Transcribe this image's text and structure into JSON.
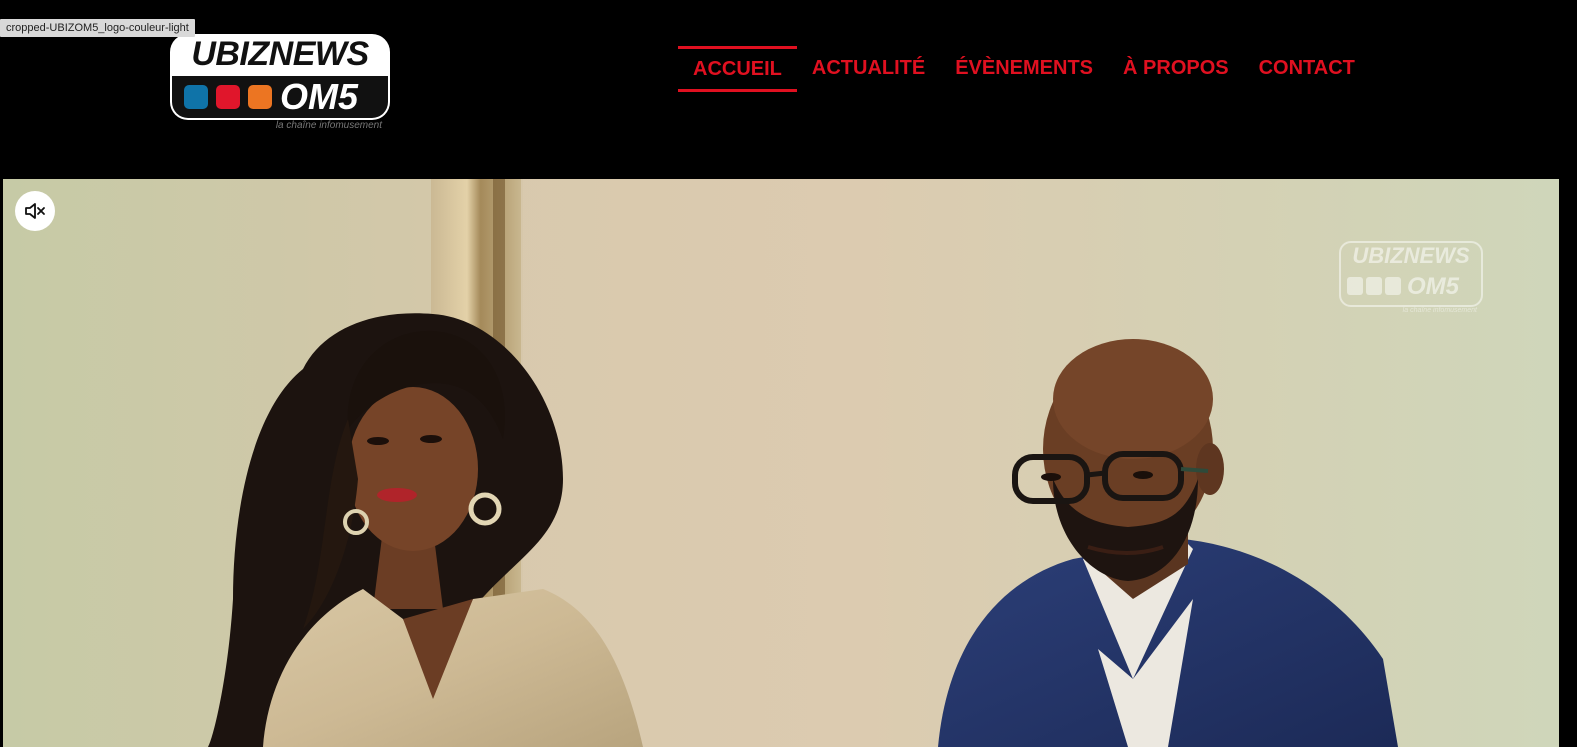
{
  "tooltip": {
    "text": "cropped-UBIZOM5_logo-couleur-light"
  },
  "logo": {
    "top_text": "UBIZNEWS",
    "bottom_text": "OM5",
    "tagline": "la chaîne infomusement",
    "square_colors": [
      "#0f73a8",
      "#e0162b",
      "#ec7522"
    ]
  },
  "nav": {
    "items": [
      {
        "label": "ACCUEIL",
        "active": true
      },
      {
        "label": "ACTUALITÉ",
        "active": false
      },
      {
        "label": "ÉVÈNEMENTS",
        "active": false
      },
      {
        "label": "À PROPOS",
        "active": false
      },
      {
        "label": "CONTACT",
        "active": false
      }
    ],
    "accent_color": "#e01020"
  },
  "video": {
    "mute_icon": "speaker-muted-icon",
    "watermark": {
      "top_text": "UBIZNEWS",
      "bottom_text": "OM5",
      "tagline": "la chaîne infomusement"
    }
  }
}
